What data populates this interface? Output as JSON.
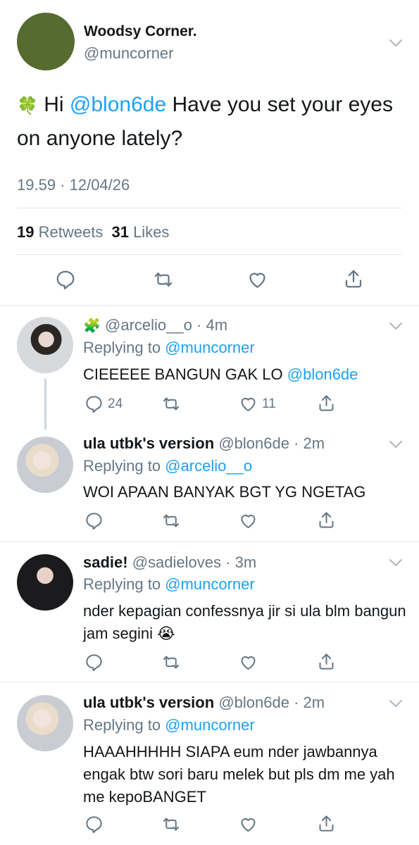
{
  "main_tweet": {
    "display_name": "Woodsy Corner.",
    "handle": "@muncorner",
    "emoji": "🍀",
    "text_prefix": "Hi",
    "mention": "@blon6de",
    "text_suffix": "Have you set your eyes on anyone lately?",
    "timestamp": "19.59 · 12/04/26",
    "retweets_count": "19",
    "retweets_label": "Retweets",
    "likes_count": "31",
    "likes_label": "Likes",
    "avatar_color": "#556b2f"
  },
  "replies": [
    {
      "badge_emoji": "🧩",
      "display_name": "",
      "handle": "@arcelio__o",
      "time": "· 4m",
      "replying_label": "Replying to",
      "replying_to": "@muncorner",
      "text": "CIEEEEE BANGUN GAK LO",
      "text_mention": "@blon6de",
      "reply_count": "24",
      "like_count": "11"
    },
    {
      "display_name": "ula utbk's version",
      "handle": "@blon6de",
      "time": "· 2m",
      "replying_label": "Replying to",
      "replying_to": "@arcelio__o",
      "text": "WOI APAAN BANYAK BGT YG NGETAG"
    },
    {
      "display_name": "sadie!",
      "handle": "@sadieloves",
      "time": "· 3m",
      "replying_label": "Replying to",
      "replying_to": "@muncorner",
      "text": "nder kepagian confessnya jir si ula blm bangun jam segini",
      "text_emoji": "😭"
    },
    {
      "display_name": "ula utbk's version",
      "handle": "@blon6de",
      "time": "· 2m",
      "replying_label": "Replying to",
      "replying_to": "@muncorner",
      "text": "HAAAHHHHH SIAPA eum nder jawbannya engak btw sori baru melek but pls dm me yah me kepoBANGET"
    }
  ],
  "colors": {
    "link_blue": "#1da1f2",
    "secondary_gray": "#657786",
    "divider": "#e1e8ed"
  }
}
